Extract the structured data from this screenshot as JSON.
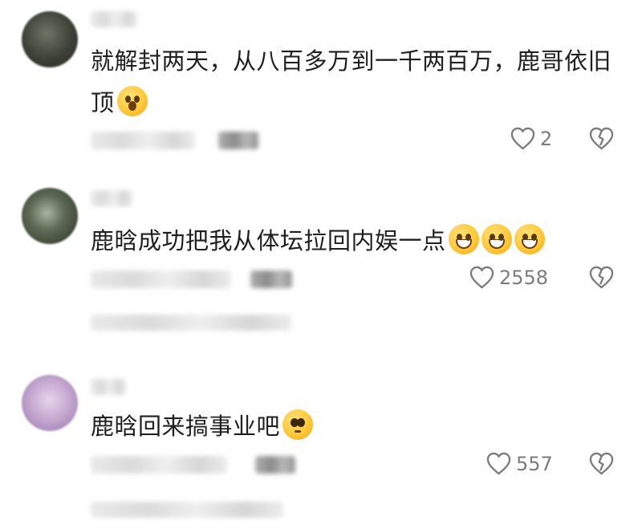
{
  "comments": [
    {
      "text": "就解封两天，从八百多万到一千两百万，鹿哥依旧",
      "text_line2": "顶",
      "emoji": "astonished-face-icon",
      "likes": "2"
    },
    {
      "text": "鹿晗成功把我从体坛拉回内娱一点",
      "emoji": "grinning-face-icon",
      "likes": "2558"
    },
    {
      "text": "鹿晗回来搞事业吧",
      "emoji": "pleading-face-icon",
      "likes": "557"
    }
  ],
  "colors": {
    "text": "#1f1f1f",
    "meta": "#7b7b7b"
  }
}
